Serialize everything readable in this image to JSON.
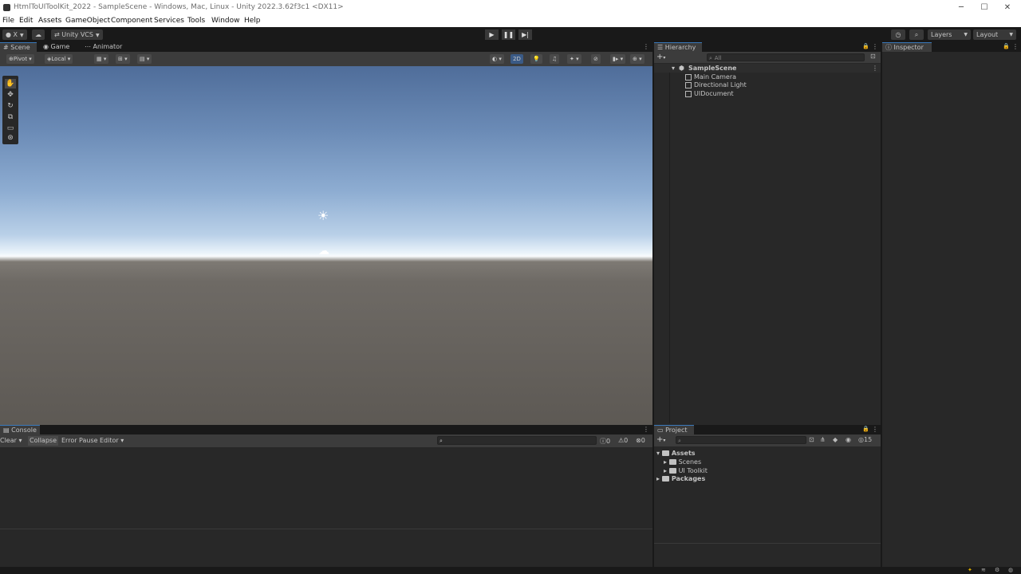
{
  "window": {
    "title": "HtmlToUIToolKit_2022 - SampleScene - Windows, Mac, Linux - Unity 2022.3.62f3c1 <DX11>"
  },
  "menu": [
    "File",
    "Edit",
    "Assets",
    "GameObject",
    "Component",
    "Services",
    "Tools",
    "Window",
    "Help"
  ],
  "toolbar": {
    "account_label": "X",
    "vcs_label": "Unity VCS",
    "layers_label": "Layers",
    "layout_label": "Layout"
  },
  "scene_tabs": [
    "Scene",
    "Game",
    "Animator"
  ],
  "scene_toolbar": {
    "pivot_label": "Pivot",
    "local_label": "Local",
    "mode_2d_label": "2D"
  },
  "console": {
    "tab_label": "Console",
    "clear_label": "Clear",
    "collapse_label": "Collapse",
    "error_pause_label": "Error Pause",
    "editor_label": "Editor",
    "log_count": "0",
    "warning_count": "0",
    "error_count": "0"
  },
  "hierarchy": {
    "tab_label": "Hierarchy",
    "search_placeholder": "All",
    "scene_name": "SampleScene",
    "objects": [
      "Main Camera",
      "Directional Light",
      "UIDocument"
    ]
  },
  "inspector": {
    "tab_label": "Inspector"
  },
  "project": {
    "tab_label": "Project",
    "hidden_count": "15",
    "tree": {
      "assets_label": "Assets",
      "assets_children": [
        "Scenes",
        "UI Toolkit"
      ],
      "packages_label": "Packages"
    }
  }
}
